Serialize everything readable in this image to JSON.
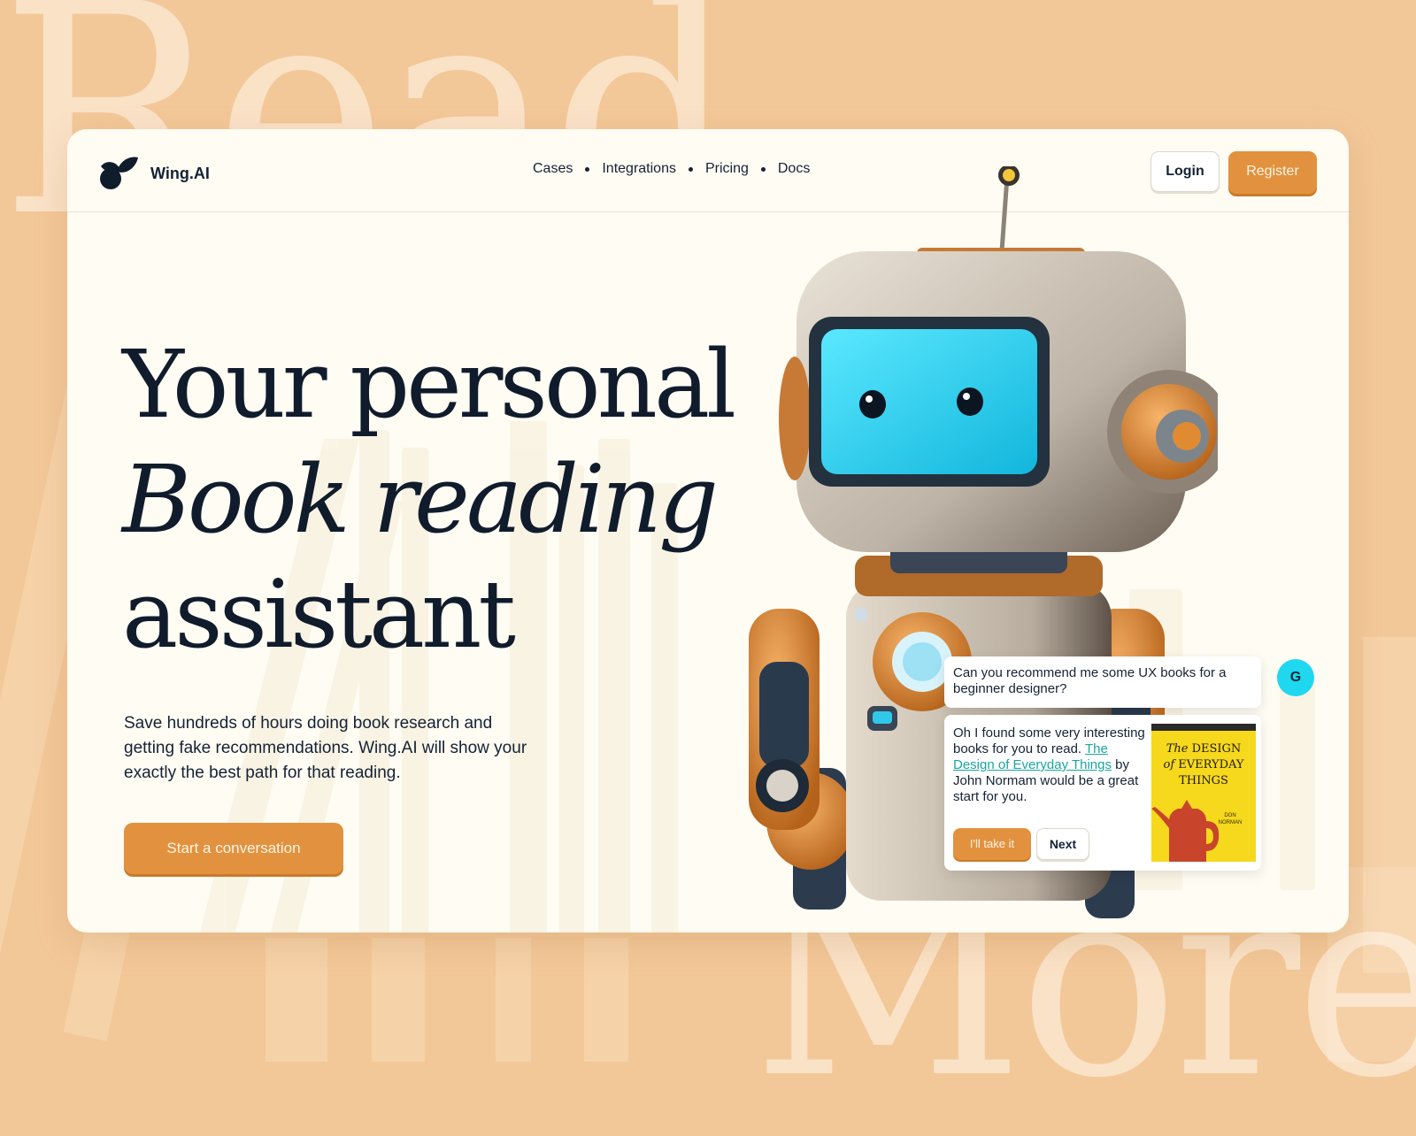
{
  "background": {
    "word_top": "Read",
    "word_bottom": "More",
    "color": "#f3c899"
  },
  "brand": {
    "name": "Wing.AI"
  },
  "nav": {
    "items": [
      {
        "label": "Cases"
      },
      {
        "label": "Integrations"
      },
      {
        "label": "Pricing"
      },
      {
        "label": "Docs"
      }
    ],
    "login_label": "Login",
    "register_label": "Register"
  },
  "hero": {
    "title_line1": "Your personal",
    "title_line2": "Book reading",
    "title_line3": "assistant",
    "subtitle": "Save hundreds of hours doing book research and getting fake recommendations. Wing.AI will show your exactly the best path for that reading.",
    "cta_label": "Start a conversation"
  },
  "chat": {
    "user_avatar": "G",
    "question": "Can you recommend me some UX books for a beginner designer?",
    "answer_prefix": "Oh I found some very interesting books for you to read.",
    "answer_link": "The Design of Everyday Things",
    "answer_suffix": "by John Normam would be a great start for you.",
    "take_label": "I'll take it",
    "next_label": "Next",
    "book": {
      "title_the": "The",
      "title_design": "DESIGN",
      "title_of": "of",
      "title_everyday": "EVERYDAY",
      "title_things": "THINGS",
      "author": "DON NORMAN"
    }
  },
  "colors": {
    "accent": "#e2923e",
    "ink": "#101c2c",
    "card": "#fefcf3",
    "link": "#1aa6a0",
    "avatar": "#1fd8ef",
    "book": "#f6d81c"
  },
  "icons": [
    "wing-logo-icon",
    "robot-illustration",
    "teapot-icon"
  ]
}
